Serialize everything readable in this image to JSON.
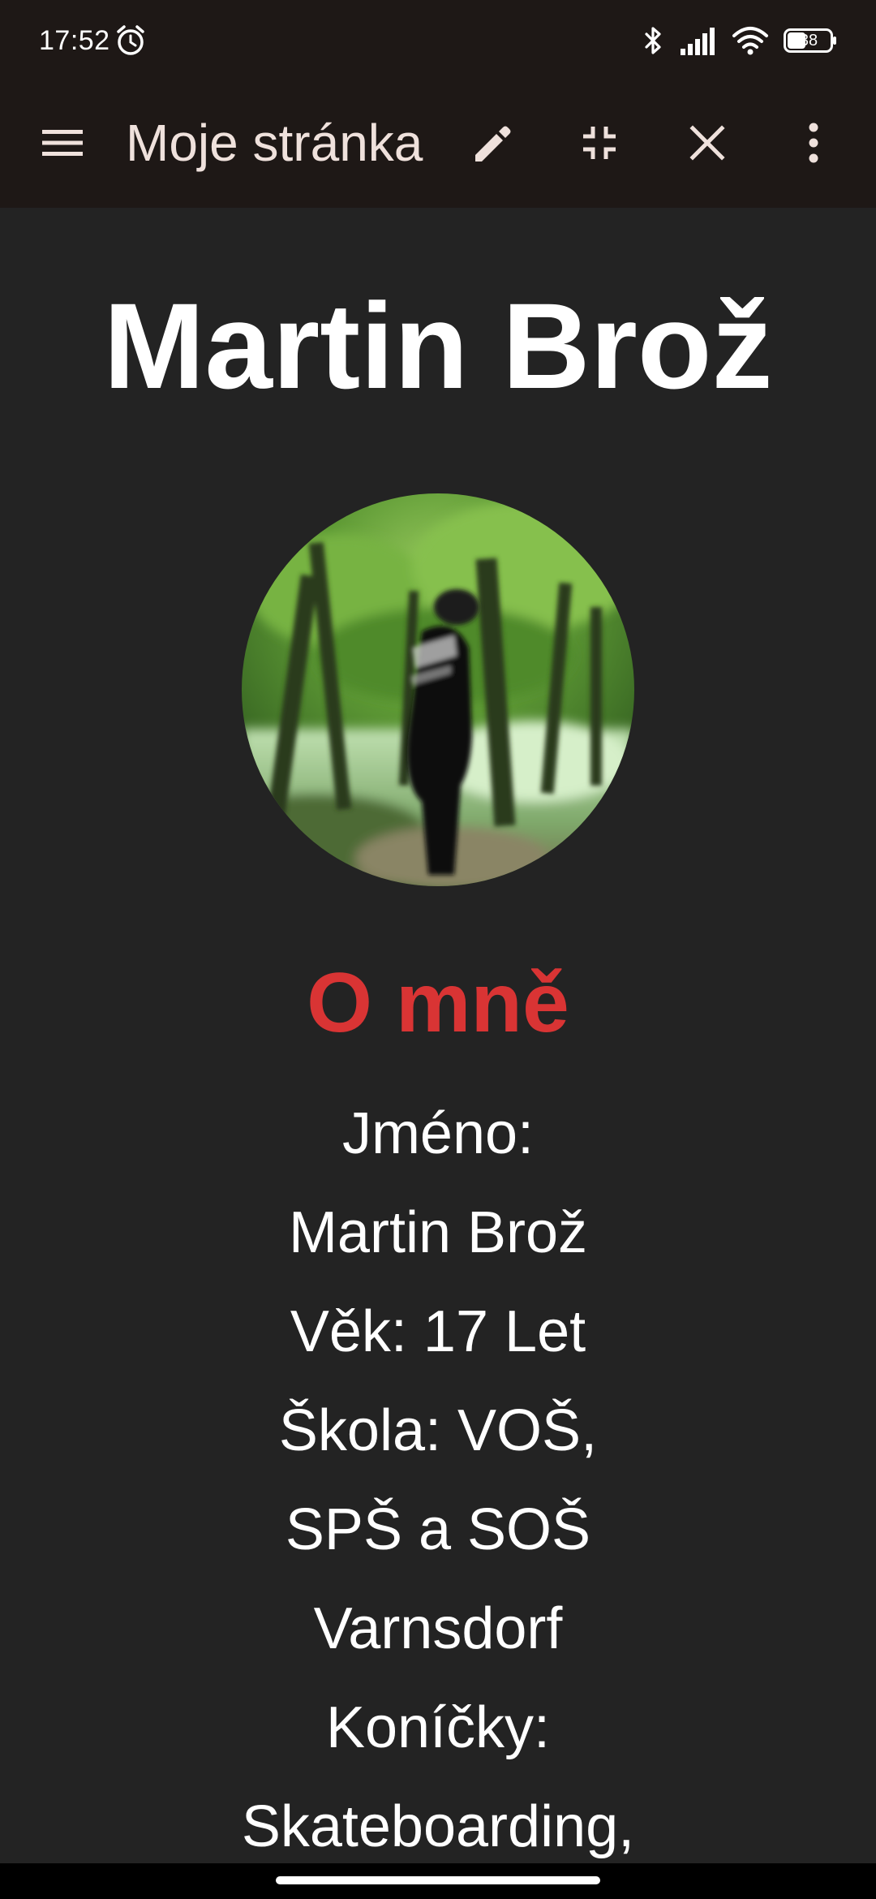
{
  "status_bar": {
    "time": "17:52",
    "battery_level": "38",
    "icons": [
      "alarm-icon",
      "bluetooth-icon",
      "signal-icon",
      "wifi-icon",
      "battery-icon"
    ]
  },
  "app_bar": {
    "title": "Moje stránka",
    "icons": [
      "menu-icon",
      "pencil-icon",
      "exit-fullscreen-icon",
      "close-icon",
      "more-vert-icon"
    ]
  },
  "page": {
    "title": "Martin Brož",
    "section_heading": "O mně",
    "about_lines": [
      "Jméno:",
      "Martin Brož",
      "Věk: 17 Let",
      "Škola: VOŠ,",
      "SPŠ a SOŠ",
      "Varnsdorf",
      "Koníčky:",
      "Skateboarding,"
    ]
  },
  "colors": {
    "app_bar_background": "#1e1816",
    "page_background": "#232323",
    "title_text": "#ffffff",
    "section_heading": "#d93434",
    "app_bar_title": "#efe1dc"
  }
}
